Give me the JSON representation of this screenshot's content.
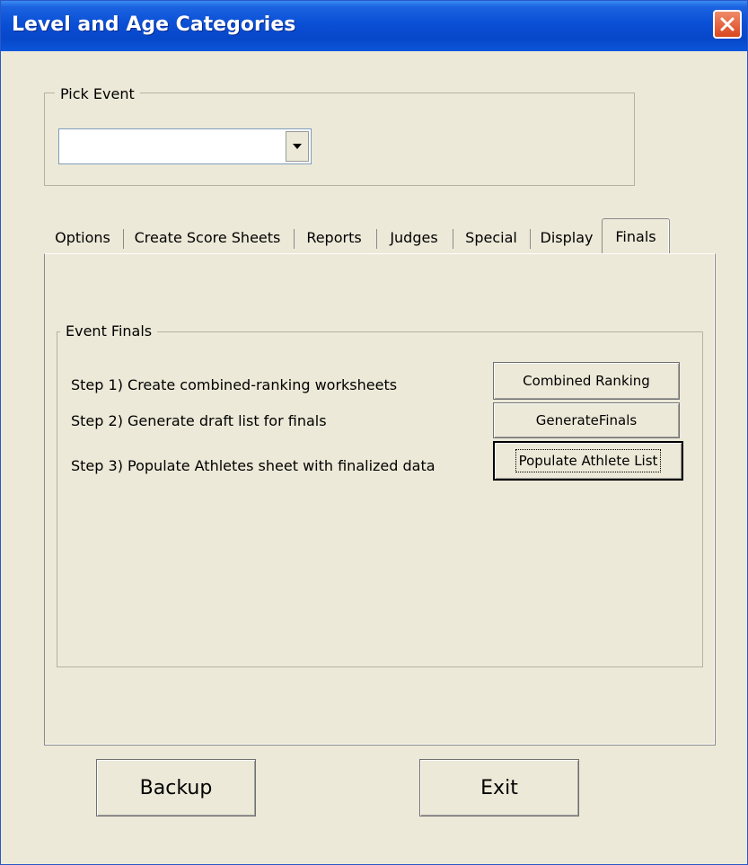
{
  "window": {
    "title": "Level and Age Categories"
  },
  "pick_event": {
    "legend": "Pick Event",
    "selected_value": ""
  },
  "tabs": [
    {
      "label": "Options"
    },
    {
      "label": "Create Score Sheets"
    },
    {
      "label": "Reports"
    },
    {
      "label": "Judges"
    },
    {
      "label": "Special"
    },
    {
      "label": "Display"
    },
    {
      "label": "Finals",
      "active": true
    }
  ],
  "event_finals": {
    "legend": "Event Finals",
    "steps": [
      {
        "text": "Step 1) Create combined-ranking worksheets",
        "button": "Combined Ranking"
      },
      {
        "text": "Step 2) Generate draft list for finals",
        "button": "GenerateFinals"
      },
      {
        "text": "Step 3) Populate Athletes sheet with finalized data",
        "button": "Populate Athlete List"
      }
    ]
  },
  "footer": {
    "backup_label": "Backup",
    "exit_label": "Exit"
  },
  "colors": {
    "title_bar": "#0a4fd6",
    "window_bg": "#ece9d8",
    "close_button": "#d9471f"
  },
  "icons": {
    "close": "close-icon",
    "dropdown": "chevron-down-icon"
  }
}
